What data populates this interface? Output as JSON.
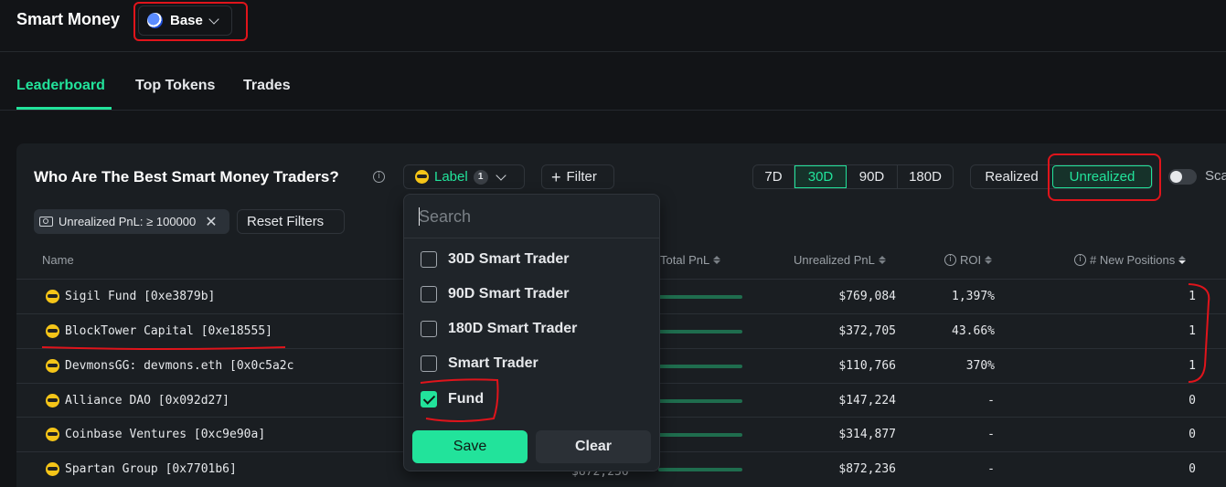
{
  "header": {
    "title": "Smart Money",
    "chain": "Base"
  },
  "tabs": [
    {
      "label": "Leaderboard",
      "active": true
    },
    {
      "label": "Top Tokens",
      "active": false
    },
    {
      "label": "Trades",
      "active": false
    }
  ],
  "card": {
    "title": "Who Are The Best Smart Money Traders?",
    "label_button": "Label",
    "label_count": "1",
    "filter_button": "Filter",
    "periods": [
      "7D",
      "30D",
      "90D",
      "180D"
    ],
    "active_period": "30D",
    "pnl_modes": [
      "Realized",
      "Unrealized"
    ],
    "active_pnl_mode": "Unrealized",
    "scale_label": "Sca",
    "active_filter_chip": "Unrealized PnL: ≥ 100000",
    "reset_button": "Reset Filters"
  },
  "table": {
    "columns": {
      "name": "Name",
      "total_pnl": "Total PnL",
      "unrealized_pnl": "Unrealized PnL",
      "roi": "ROI",
      "new_positions": "# New Positions"
    },
    "rows": [
      {
        "name": "Sigil Fund [0xe3879b]",
        "unrealized_pnl": "$769,084",
        "roi": "1,397%",
        "new_positions": "1"
      },
      {
        "name": "BlockTower Capital [0xe18555]",
        "unrealized_pnl": "$372,705",
        "roi": "43.66%",
        "new_positions": "1"
      },
      {
        "name": "DevmonsGG: devmons.eth [0x0c5a2c",
        "unrealized_pnl": "$110,766",
        "roi": "370%",
        "new_positions": "1"
      },
      {
        "name": "Alliance DAO [0x092d27]",
        "unrealized_pnl": "$147,224",
        "roi": "-",
        "new_positions": "0"
      },
      {
        "name": "Coinbase Ventures [0xc9e90a]",
        "unrealized_pnl": "$314,877",
        "roi": "-",
        "new_positions": "0"
      },
      {
        "name": "Spartan Group [0x7701b6]",
        "unrealized_pnl": "$872,236",
        "roi": "-",
        "new_positions": "0"
      }
    ],
    "partial_total_pnl_last_row": "$872,236"
  },
  "label_dropdown": {
    "search_placeholder": "Search",
    "options": [
      {
        "label": "30D Smart Trader",
        "checked": false
      },
      {
        "label": "90D Smart Trader",
        "checked": false
      },
      {
        "label": "180D Smart Trader",
        "checked": false
      },
      {
        "label": "Smart Trader",
        "checked": false
      },
      {
        "label": "Fund",
        "checked": true
      }
    ],
    "save_button": "Save",
    "clear_button": "Clear"
  },
  "colors": {
    "accent": "#22e39b",
    "background": "#121417",
    "card": "#1a1e22",
    "annotation": "#e0141b"
  },
  "icons": {
    "chain": "base-chain-icon",
    "info": "info-icon",
    "trader": "sunglasses-emoji-icon",
    "chip": "money-icon",
    "close": "close-icon"
  }
}
